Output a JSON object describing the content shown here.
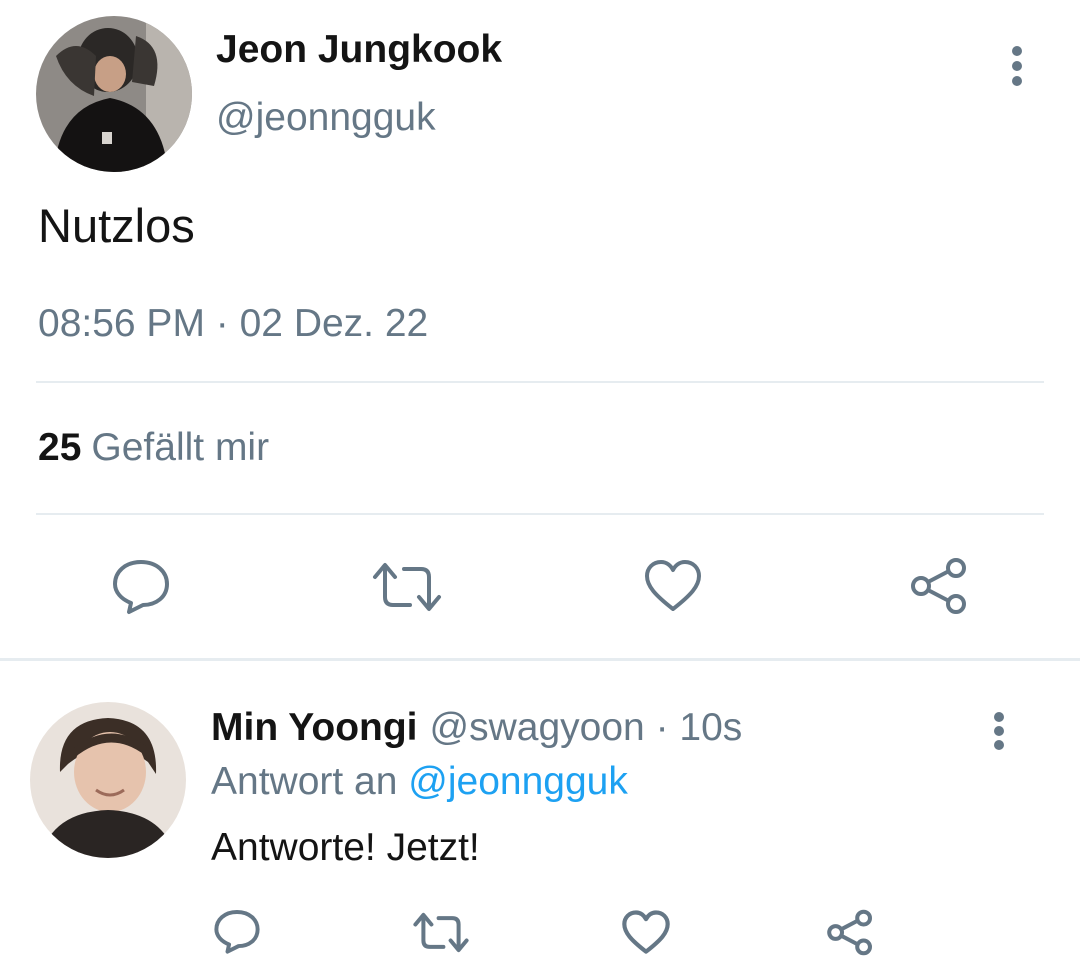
{
  "main_tweet": {
    "author_name": "Jeon Jungkook",
    "author_handle": "@jeonngguk",
    "text": "Nutzlos",
    "time": "08:56 PM",
    "separator": " · ",
    "date": "02 Dez. 22",
    "likes_count": "25",
    "likes_label": "Gefällt mir",
    "actions": [
      "reply-icon",
      "retweet-icon",
      "like-icon",
      "share-icon"
    ]
  },
  "reply": {
    "author_name": "Min Yoongi",
    "author_handle": "@swagyoon",
    "separator": " · ",
    "age": "10s",
    "reply_prefix": "Antwort an ",
    "reply_target": "@jeonngguk",
    "text": "Antworte! Jetzt!",
    "actions": [
      "reply-icon",
      "retweet-icon",
      "like-icon",
      "share-icon"
    ]
  },
  "colors": {
    "primary_text": "#141414",
    "secondary_text": "#657786",
    "link": "#1da1f2",
    "divider": "#e6ecf0"
  }
}
